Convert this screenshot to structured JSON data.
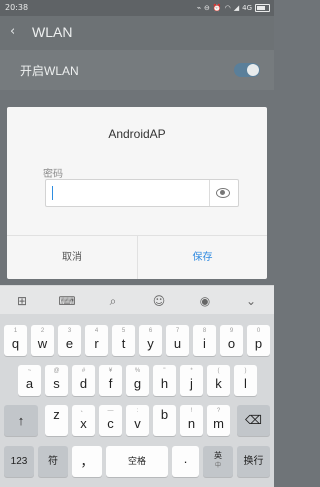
{
  "status_bar": {
    "time": "20:38",
    "network": "4G",
    "icons": [
      "shake-icon",
      "no-disturb-icon",
      "alarm-icon",
      "wifi-icon",
      "signal-icon",
      "battery-icon"
    ]
  },
  "header": {
    "back_icon": "chevron-left-icon",
    "title": "WLAN"
  },
  "setting_row": {
    "label": "开启WLAN",
    "enabled": true
  },
  "dialog": {
    "title": "AndroidAP",
    "password_label": "密码",
    "password_value": "",
    "eye_icon": "eye-icon",
    "cancel_label": "取消",
    "save_label": "保存"
  },
  "keyboard_toolbar": [
    "grid-icon",
    "keyboard-icon",
    "search-icon",
    "emoji-icon",
    "microphone-icon",
    "chevron-down-icon"
  ],
  "keyboard": {
    "row1": [
      {
        "hint": "1",
        "ch": "q"
      },
      {
        "hint": "2",
        "ch": "w"
      },
      {
        "hint": "3",
        "ch": "e"
      },
      {
        "hint": "4",
        "ch": "r"
      },
      {
        "hint": "5",
        "ch": "t"
      },
      {
        "hint": "6",
        "ch": "y"
      },
      {
        "hint": "7",
        "ch": "u"
      },
      {
        "hint": "8",
        "ch": "i"
      },
      {
        "hint": "9",
        "ch": "o"
      },
      {
        "hint": "0",
        "ch": "p"
      }
    ],
    "row2": [
      {
        "hint": "~",
        "ch": "a"
      },
      {
        "hint": "@",
        "ch": "s"
      },
      {
        "hint": "#",
        "ch": "d"
      },
      {
        "hint": "¥",
        "ch": "f"
      },
      {
        "hint": "%",
        "ch": "g"
      },
      {
        "hint": "\"",
        "ch": "h"
      },
      {
        "hint": "*",
        "ch": "j"
      },
      {
        "hint": "(",
        "ch": "k"
      },
      {
        "hint": ")",
        "ch": "l"
      }
    ],
    "row3": [
      {
        "hint": "",
        "ch": "z"
      },
      {
        "hint": "、",
        "ch": "x"
      },
      {
        "hint": "—",
        "ch": "c"
      },
      {
        "hint": ":",
        "ch": "v"
      },
      {
        "hint": "",
        "ch": "b"
      },
      {
        "hint": "!",
        "ch": "n"
      },
      {
        "hint": "?",
        "ch": "m"
      }
    ],
    "shift_icon": "shift-arrow-icon",
    "backspace_icon": "backspace-icon",
    "row4": {
      "num": "123",
      "symbol": "符",
      "comma": "，",
      "space": "空格",
      "dot": "·",
      "lang_top": "英",
      "lang_bottom": "中",
      "enter": "换行"
    }
  }
}
